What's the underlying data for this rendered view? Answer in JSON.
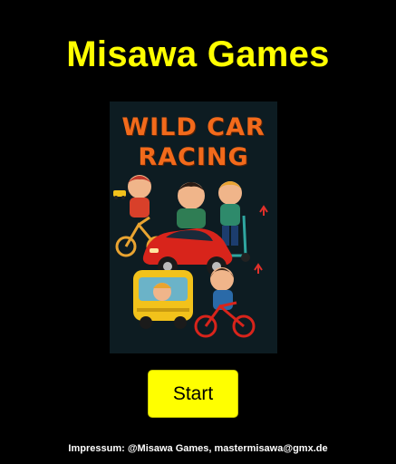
{
  "header": {
    "title": "Misawa Games"
  },
  "game_cover": {
    "title_line1": "WILD CAR",
    "title_line2": "RACING",
    "title_color": "#f26a1b",
    "background_color": "#0d1c22"
  },
  "start_button": {
    "label": "Start",
    "color": "#ffff00"
  },
  "footer": {
    "text": "Impressum: @Misawa Games, mastermisawa@gmx.de"
  },
  "colors": {
    "page_background": "#000000",
    "title_color": "#ffff00",
    "footer_text": "#ffffff"
  }
}
